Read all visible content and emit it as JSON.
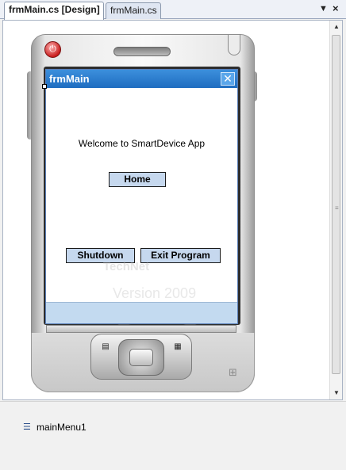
{
  "tabs": [
    {
      "label": "frmMain.cs [Design]",
      "active": true
    },
    {
      "label": "frmMain.cs",
      "active": false
    }
  ],
  "tab_controls": {
    "dropdown_icon": "chevron-down-icon",
    "close_icon": "close-icon"
  },
  "form": {
    "title": "frmMain",
    "welcome_text": "Welcome to SmartDevice App",
    "buttons": {
      "home": "Home",
      "shutdown": "Shutdown",
      "exit": "Exit Program"
    }
  },
  "watermark": {
    "text": "TechNet",
    "version": "Version 2009"
  },
  "tray": {
    "items": [
      {
        "label": "mainMenu1",
        "icon": "main-menu-icon"
      }
    ]
  },
  "colors": {
    "titlebar": "#1f6dc0",
    "button_face": "#c6d8ee",
    "menubar": "#c3daf0"
  }
}
